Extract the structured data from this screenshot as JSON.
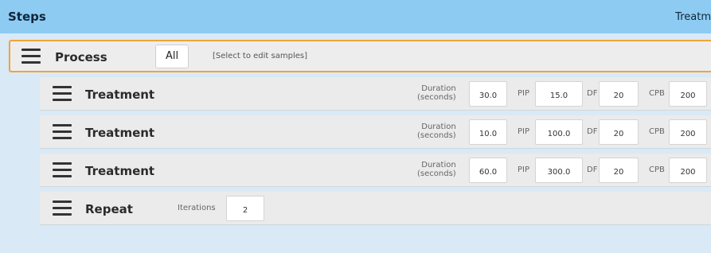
{
  "header": {
    "title": "Steps",
    "right_label": "Treatm"
  },
  "process": {
    "label": "Process",
    "tab_all": "All",
    "select_hint": "[Select to edit samples]"
  },
  "steps": [
    {
      "label": "Treatment",
      "duration_label": "Duration\n(seconds)",
      "duration": "30.0",
      "pip_label": "PIP",
      "pip": "15.0",
      "df_label": "DF",
      "df": "20",
      "cpb_label": "CPB",
      "cpb": "200"
    },
    {
      "label": "Treatment",
      "duration_label": "Duration\n(seconds)",
      "duration": "10.0",
      "pip_label": "PIP",
      "pip": "100.0",
      "df_label": "DF",
      "df": "20",
      "cpb_label": "CPB",
      "cpb": "200"
    },
    {
      "label": "Treatment",
      "duration_label": "Duration\n(seconds)",
      "duration": "60.0",
      "pip_label": "PIP",
      "pip": "300.0",
      "df_label": "DF",
      "df": "20",
      "cpb_label": "CPB",
      "cpb": "200"
    }
  ],
  "repeat": {
    "label": "Repeat",
    "iterations_label": "Iterations",
    "iterations": "2"
  },
  "colors": {
    "header_bg": "#8ecbf2",
    "selected_border": "#f2a33a",
    "page_bg": "#d9e9f6"
  }
}
